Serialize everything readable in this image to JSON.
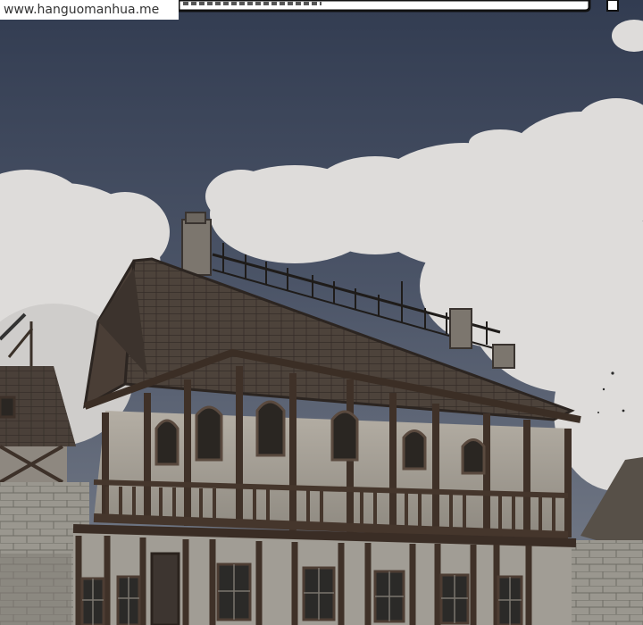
{
  "watermark": {
    "text": "www.hanguomanhua.me"
  },
  "scene": {
    "subject": "manga-panel-medieval-timber-house",
    "colors": {
      "sky_top": "#323c51",
      "sky_bottom": "#6e7583",
      "cloud": "#dcdcdc",
      "roof": "#4a4039",
      "timber": "#4b3c31",
      "wall": "#a8a39a",
      "stone": "#8d8a84"
    }
  }
}
